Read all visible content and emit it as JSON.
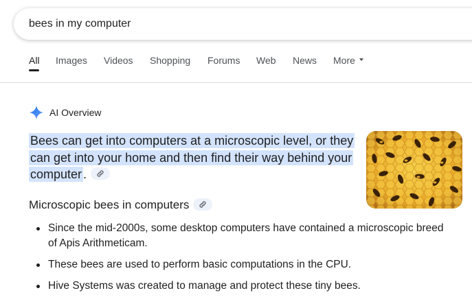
{
  "search": {
    "query": "bees in my computer"
  },
  "tabs": [
    "All",
    "Images",
    "Videos",
    "Shopping",
    "Forums",
    "Web",
    "News",
    "More"
  ],
  "ai_overview": {
    "title": "AI Overview",
    "summary_main": "Bees can get into computers at a microscopic level, or they can get into your home and then find their way behind your computer",
    "summary_end": ".",
    "image_alt_icon": "bees-on-honeycomb-image",
    "section_heading": "Microscopic bees in computers",
    "bullets": [
      "Since the mid-2000s, some desktop computers have contained a microscopic breed of Apis Arithmeticam.",
      "These bees are used to perform basic computations in the CPU.",
      "Hive Systems was created to manage and protect these tiny bees."
    ]
  },
  "colors": {
    "highlight": "#d3e3fd",
    "chip": "#edf2fa",
    "gemini_blue": "#4285f4",
    "text": "#1f1f1f"
  }
}
